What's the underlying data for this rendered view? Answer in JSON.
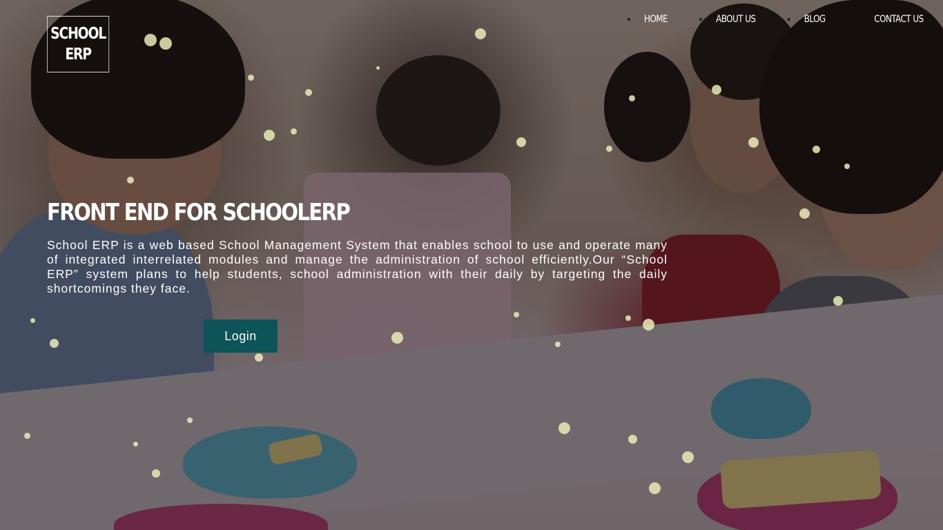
{
  "brand": {
    "logo_line1": "SCHOOL",
    "logo_line2": "ERP"
  },
  "nav": {
    "items": [
      {
        "label": "HOME"
      },
      {
        "label": "ABOUT US"
      },
      {
        "label": "BLOG"
      },
      {
        "label": "CONTACT US"
      }
    ]
  },
  "hero": {
    "title": "FRONT END FOR SCHOOLERP",
    "description": "School ERP is a web based School Management System that enables school to use and operate many of integrated interrelated modules and manage the administration of school efficiently.Our “School ERP” system plans to help students, school administration with their daily by targeting the daily shortcomings they face.",
    "login_label": "Login"
  },
  "colors": {
    "login_button": "#0c5458",
    "text": "#ffffff",
    "particles": "#e9ecb6"
  }
}
